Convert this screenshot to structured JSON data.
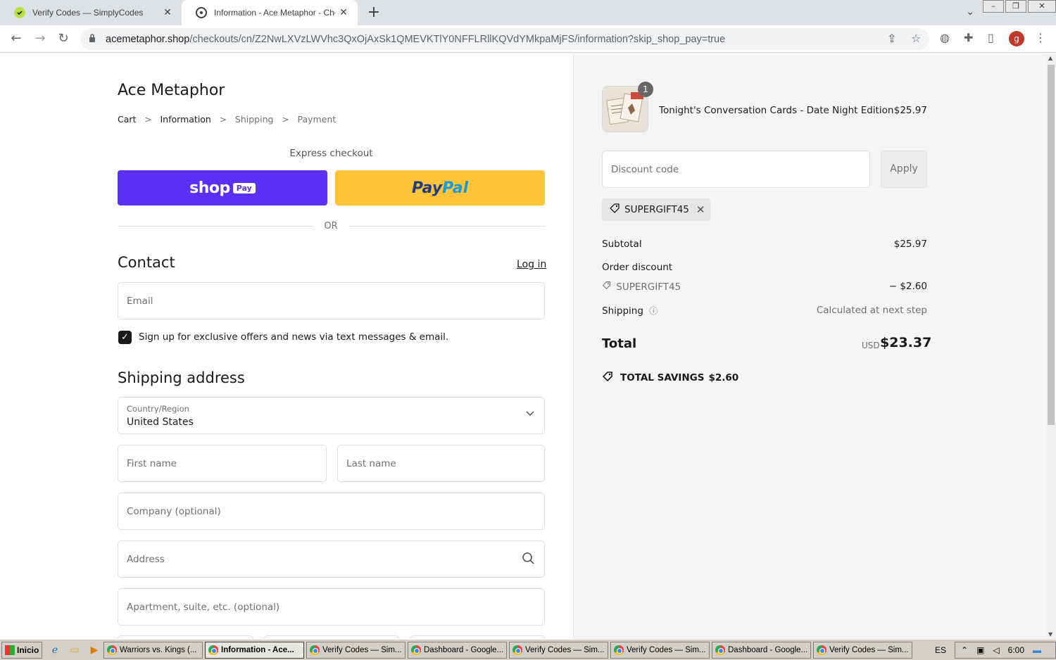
{
  "browser": {
    "tabs": [
      {
        "title": "Verify Codes — SimplyCodes",
        "active": false
      },
      {
        "title": "Information - Ace Metaphor - Checkout",
        "active": true
      }
    ],
    "url_domain": "acemetaphor.shop",
    "url_path": "/checkouts/cn/Z2NwLXVzLWVhc3QxOjAxSk1QMEVKTlY0NFFLRllKQVdYMkpaMjFS/information?skip_shop_pay=true",
    "profile_initial": "g"
  },
  "checkout": {
    "shop_name": "Ace Metaphor",
    "breadcrumbs": [
      "Cart",
      "Information",
      "Shipping",
      "Payment"
    ],
    "express_checkout": "Express checkout",
    "shop_pay_logo": "shop",
    "shop_pay_badge": "Pay",
    "paypal_part1": "Pay",
    "paypal_part2": "Pal",
    "or_divider": "OR",
    "contact_heading": "Contact",
    "login_link": "Log in",
    "email_placeholder": "Email",
    "marketing_checkbox_checked": true,
    "marketing_label": "Sign up for exclusive offers and news via text messages & email.",
    "shipping_heading": "Shipping address",
    "country_label": "Country/Region",
    "country_value": "United States",
    "first_name_placeholder": "First name",
    "last_name_placeholder": "Last name",
    "company_placeholder": "Company (optional)",
    "address_placeholder": "Address",
    "apartment_placeholder": "Apartment, suite, etc. (optional)"
  },
  "summary": {
    "item": {
      "quantity": "1",
      "name": "Tonight's Conversation Cards - Date Night Edition",
      "price": "$25.97"
    },
    "discount_placeholder": "Discount code",
    "apply_label": "Apply",
    "applied_code": "SUPERGIFT45",
    "subtotal_label": "Subtotal",
    "subtotal_value": "$25.97",
    "order_discount_label": "Order discount",
    "discount_code": "SUPERGIFT45",
    "discount_value": "− $2.60",
    "shipping_label": "Shipping",
    "shipping_value": "Calculated at next step",
    "total_label": "Total",
    "currency": "USD",
    "total_value": "$23.37",
    "savings_label": "TOTAL SAVINGS",
    "savings_value": "$2.60"
  },
  "taskbar": {
    "start_label": "Inicio",
    "tasks": [
      {
        "title": "Warriors vs. Kings (...",
        "active": false
      },
      {
        "title": "Information - Ace...",
        "active": true
      },
      {
        "title": "Verify Codes — Sim...",
        "active": false
      },
      {
        "title": "Dashboard - Google...",
        "active": false
      },
      {
        "title": "Verify Codes — Sim...",
        "active": false
      },
      {
        "title": "Verify Codes — Sim...",
        "active": false
      },
      {
        "title": "Dashboard - Google...",
        "active": false
      },
      {
        "title": "Verify Codes — Sim...",
        "active": false
      }
    ],
    "language": "ES",
    "clock": "6:00"
  },
  "colors": {
    "shop_pay": "#5a31f4",
    "paypal": "#ffc439",
    "summary_bg": "#f5f5f5"
  }
}
